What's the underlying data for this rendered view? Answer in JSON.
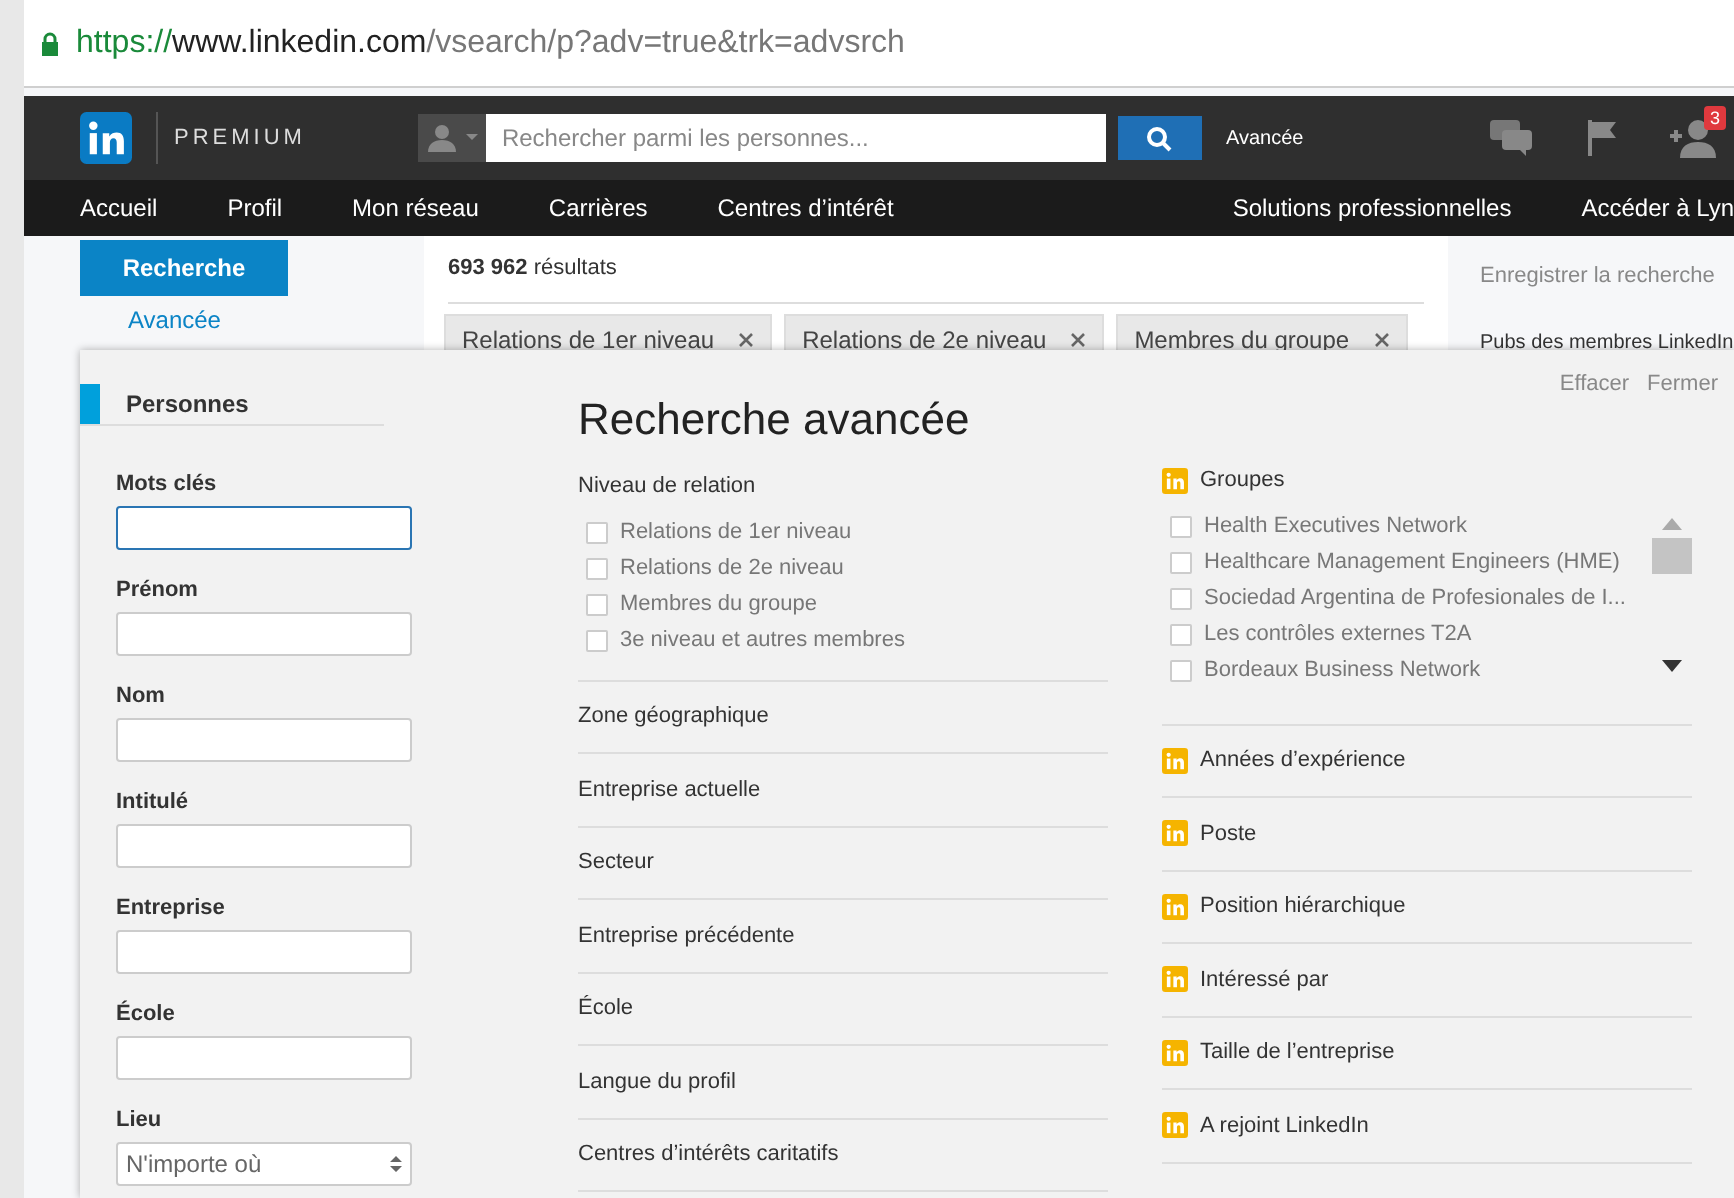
{
  "address_bar": {
    "scheme": "https://",
    "host": "www.linkedin.com",
    "path": "/vsearch/p?adv=true&trk=advsrch"
  },
  "top_bar": {
    "brand": "PREMIUM",
    "search_placeholder": "Rechercher parmi les personnes...",
    "advanced_link": "Avancée",
    "notification_count": "3"
  },
  "nav": {
    "left": [
      "Accueil",
      "Profil",
      "Mon réseau",
      "Carrières",
      "Centres d’intérêt"
    ],
    "right": [
      "Solutions professionnelles",
      "Accéder à Lyn"
    ]
  },
  "left_menu": [
    {
      "label": "Recherche",
      "selected": true
    },
    {
      "label": "Avancée",
      "selected": false
    }
  ],
  "results": {
    "count": "693 962",
    "label": "résultats"
  },
  "chips": [
    "Relations de 1er niveau",
    "Relations de 2e niveau",
    "Membres du groupe"
  ],
  "right_rail": {
    "save": "Enregistrer la recherche",
    "ads": "Pubs des membres LinkedIn"
  },
  "panel": {
    "title": "Recherche avancée",
    "actions": [
      "Effacer",
      "Fermer"
    ],
    "tab": "Personnes",
    "fields": [
      {
        "label": "Mots clés",
        "kind": "text",
        "focused": true
      },
      {
        "label": "Prénom",
        "kind": "text",
        "focused": false
      },
      {
        "label": "Nom",
        "kind": "text",
        "focused": false
      },
      {
        "label": "Intitulé",
        "kind": "text",
        "focused": false
      },
      {
        "label": "Entreprise",
        "kind": "text",
        "focused": false
      },
      {
        "label": "École",
        "kind": "text",
        "focused": false
      },
      {
        "label": "Lieu",
        "kind": "select",
        "value": "N'importe où",
        "focused": false
      }
    ],
    "relation": {
      "heading": "Niveau de relation",
      "options": [
        {
          "label": "Relations de 1er niveau",
          "checked": false
        },
        {
          "label": "Relations de 2e niveau",
          "checked": false
        },
        {
          "label": "Membres du groupe",
          "checked": false
        },
        {
          "label": "3e niveau et autres membres",
          "checked": false
        }
      ]
    },
    "sections": [
      "Zone géographique",
      "Entreprise actuelle",
      "Secteur",
      "Entreprise précédente",
      "École",
      "Langue du profil",
      "Centres d’intérêts caritatifs"
    ],
    "groups": {
      "heading": "Groupes",
      "options": [
        {
          "label": "Health Executives Network",
          "checked": false
        },
        {
          "label": "Healthcare Management Engineers (HME)",
          "checked": false
        },
        {
          "label": "Sociedad Argentina de Profesionales de I...",
          "checked": false
        },
        {
          "label": "Les contrôles externes T2A",
          "checked": false
        },
        {
          "label": "Bordeaux Business Network",
          "checked": false
        }
      ]
    },
    "premium_sections": [
      "Années d’expérience",
      "Poste",
      "Position hiérarchique",
      "Intéressé par",
      "Taille de l’entreprise",
      "A rejoint LinkedIn"
    ]
  }
}
